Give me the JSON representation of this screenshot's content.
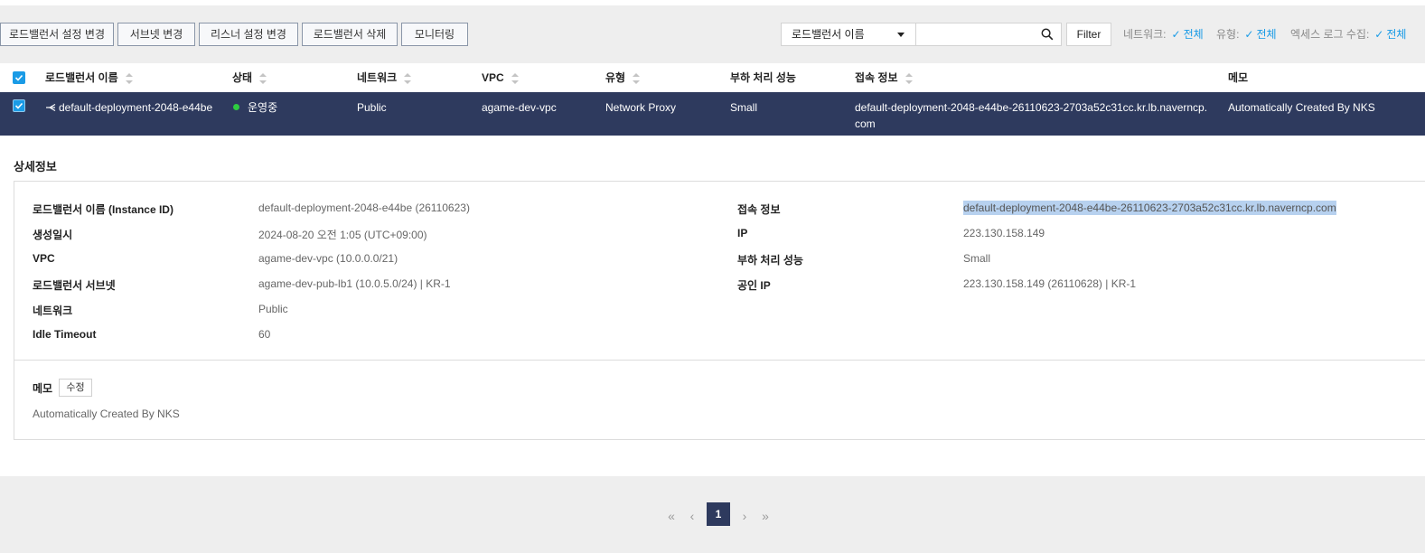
{
  "toolbar": {
    "buttons": [
      {
        "label": "로드밸런서 설정 변경"
      },
      {
        "label": "서브넷 변경"
      },
      {
        "label": "리스너 설정 변경"
      },
      {
        "label": "로드밸런서 삭제"
      },
      {
        "label": "모니터링"
      }
    ],
    "search_select": "로드밸런서 이름",
    "search_value": "",
    "filter_label": "Filter",
    "filters": [
      {
        "label": "네트워크:",
        "value": "전체"
      },
      {
        "label": "유형:",
        "value": "전체"
      },
      {
        "label": "엑세스 로그 수집:",
        "value": "전체"
      }
    ]
  },
  "table": {
    "columns": [
      "로드밸런서 이름",
      "상태",
      "네트워크",
      "VPC",
      "유형",
      "부하 처리 성능",
      "접속 정보",
      "메모"
    ],
    "rows": [
      {
        "name": "default-deployment-2048-e44be",
        "status": "운영중",
        "network": "Public",
        "vpc": "agame-dev-vpc",
        "type": "Network Proxy",
        "performance": "Small",
        "access_line1": "default-deployment-2048-e44be-26110623-2703a52c31cc.kr.lb.naverncp.",
        "access_line2": "com",
        "memo": "Automatically Created By NKS",
        "checked": true
      }
    ]
  },
  "detail": {
    "title": "상세정보",
    "left": [
      {
        "label": "로드밸런서 이름 (Instance ID)",
        "value": "default-deployment-2048-e44be (26110623)"
      },
      {
        "label": "생성일시",
        "value": "2024-08-20 오전 1:05 (UTC+09:00)"
      },
      {
        "label": "VPC",
        "value": "agame-dev-vpc (10.0.0.0/21)"
      },
      {
        "label": "로드밸런서 서브넷",
        "value": "agame-dev-pub-lb1 (10.0.5.0/24) | KR-1"
      },
      {
        "label": "네트워크",
        "value": "Public"
      },
      {
        "label": "Idle Timeout",
        "value": "60"
      }
    ],
    "right": [
      {
        "label": "접속 정보",
        "value": "default-deployment-2048-e44be-26110623-2703a52c31cc.kr.lb.naverncp.com"
      },
      {
        "label": "IP",
        "value": "223.130.158.149"
      },
      {
        "label": "부하 처리 성능",
        "value": "Small"
      },
      {
        "label": "공인 IP",
        "value": "223.130.158.149 (26110628) | KR-1"
      }
    ],
    "memo_label": "메모",
    "memo_edit": "수정",
    "memo_text": "Automatically Created By NKS"
  },
  "pagination": {
    "first": "«",
    "prev": "‹",
    "current": "1",
    "next": "›",
    "last": "»"
  },
  "colors": {
    "selected_row": "#2e3a5e",
    "accent": "#1a9be6",
    "status_ok": "#2ecc40"
  }
}
